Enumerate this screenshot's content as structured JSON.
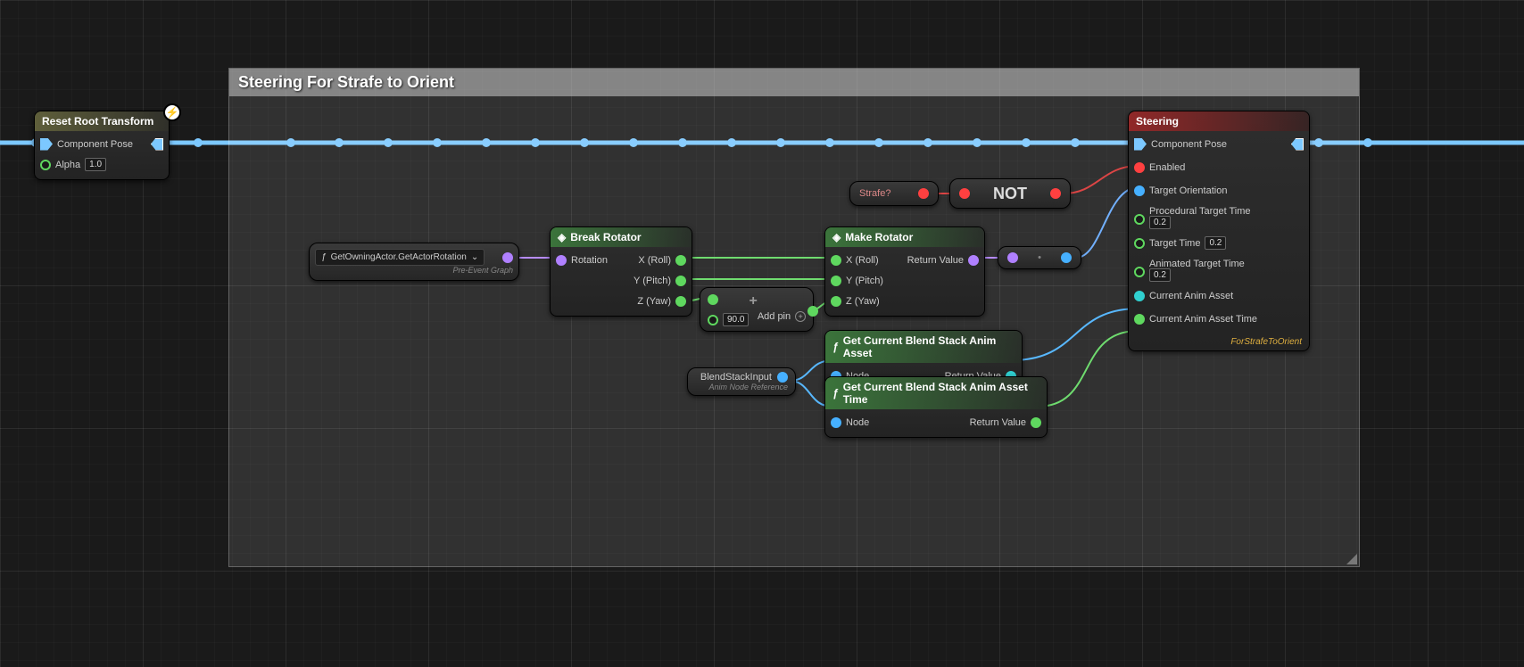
{
  "comment": {
    "title": "Steering For Strafe to Orient"
  },
  "reset_root": {
    "title": "Reset Root Transform",
    "pose_label": "Component Pose",
    "alpha_label": "Alpha",
    "alpha_value": "1.0"
  },
  "get_actor_rotation": {
    "label": "GetOwningActor.GetActorRotation",
    "subtext": "Pre-Event Graph"
  },
  "break_rotator": {
    "title": "Break Rotator",
    "in_rotation": "Rotation",
    "out_x": "X (Roll)",
    "out_y": "Y (Pitch)",
    "out_z": "Z (Yaw)"
  },
  "add_node": {
    "value": "90.0",
    "add_pin": "Add pin"
  },
  "make_rotator": {
    "title": "Make Rotator",
    "in_x": "X (Roll)",
    "in_y": "Y (Pitch)",
    "in_z": "Z (Yaw)",
    "out": "Return Value"
  },
  "strafe": {
    "label": "Strafe?"
  },
  "not": {
    "label": "NOT"
  },
  "blend_input": {
    "title": "BlendStackInput",
    "subtext": "Anim Node Reference"
  },
  "get_asset": {
    "title": "Get Current Blend Stack Anim Asset",
    "in": "Node",
    "out": "Return Value"
  },
  "get_asset_time": {
    "title": "Get Current Blend Stack Anim Asset Time",
    "in": "Node",
    "out": "Return Value"
  },
  "steering": {
    "title": "Steering",
    "pose": "Component Pose",
    "enabled": "Enabled",
    "target_orientation": "Target Orientation",
    "proc_target_time_label": "Procedural Target Time",
    "proc_target_time_value": "0.2",
    "target_time_label": "Target Time",
    "target_time_value": "0.2",
    "anim_target_time_label": "Animated Target Time",
    "anim_target_time_value": "0.2",
    "current_anim_asset": "Current Anim Asset",
    "current_anim_asset_time": "Current Anim Asset Time",
    "tag": "ForStrafeToOrient"
  }
}
